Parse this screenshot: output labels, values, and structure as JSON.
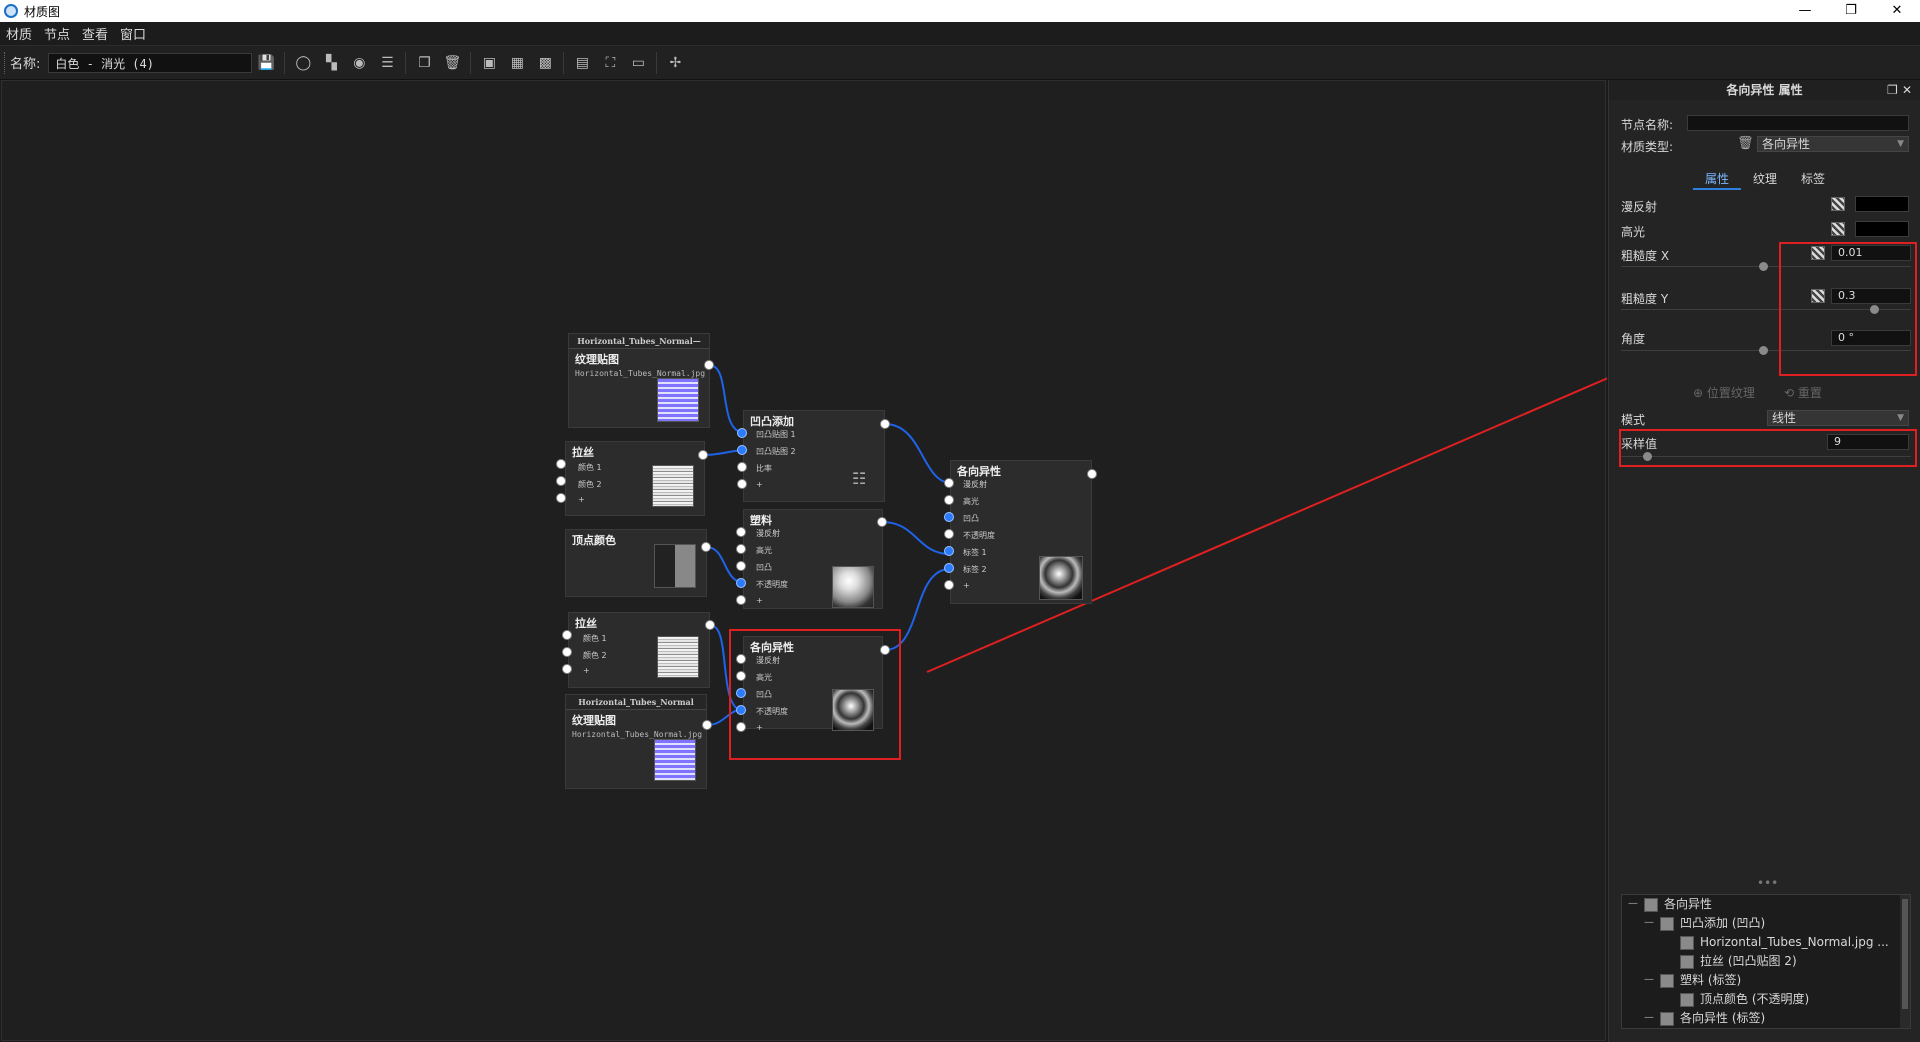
{
  "window": {
    "title": "材质图",
    "buttons": [
      "—",
      "❐",
      "✕"
    ]
  },
  "menu": [
    "材质",
    "节点",
    "查看",
    "窗口"
  ],
  "toolbar": {
    "name_label": "名称:",
    "name_value": "白色 - 消光 (4)"
  },
  "panel": {
    "title": "各向异性 属性",
    "node_name_label": "节点名称:",
    "node_name_value": "",
    "material_type_label": "材质类型:",
    "material_type_value": "各向异性",
    "tabs": [
      "属性",
      "纹理",
      "标签"
    ],
    "diffuse_label": "漫反射",
    "specular_label": "高光",
    "roughness_x_label": "粗糙度 X",
    "roughness_x_value": "0.01",
    "roughness_y_label": "粗糙度 Y",
    "roughness_y_value": "0.3",
    "angle_label": "角度",
    "angle_value": "0 °",
    "position_texture_label": "位置纹理",
    "reset_label": "重置",
    "mode_label": "模式",
    "mode_value": "线性",
    "sample_label": "采样值",
    "sample_value": "9",
    "accent": "#2f7fe0",
    "highlight": "#e02020"
  },
  "tree": [
    {
      "label": "各向异性",
      "level": 0
    },
    {
      "label": "凹凸添加 (凹凸)",
      "level": 1
    },
    {
      "label": "Horizontal_Tubes_Normal.jpg ...",
      "level": 2
    },
    {
      "label": "拉丝 (凹凸贴图 2)",
      "level": 2
    },
    {
      "label": "塑料 (标签)",
      "level": 1
    },
    {
      "label": "顶点颜色 (不透明度)",
      "level": 2
    },
    {
      "label": "各向异性 (标签)",
      "level": 1
    }
  ],
  "nodes": {
    "tex1": {
      "header": "Horizontal_Tubes_Normal—",
      "title": "纹理贴图",
      "file": "Horizontal_Tubes_Normal.jpg"
    },
    "brush1": {
      "title": "拉丝",
      "ports": [
        "颜色 1",
        "颜色 2",
        "+"
      ]
    },
    "vertex": {
      "title": "顶点颜色"
    },
    "brush2": {
      "title": "拉丝",
      "ports": [
        "颜色 1",
        "颜色 2",
        "+"
      ]
    },
    "tex2": {
      "header": "Horizontal_Tubes_Normal",
      "title": "纹理贴图",
      "file": "Horizontal_Tubes_Normal.jpg"
    },
    "bumpadd": {
      "title": "凹凸添加",
      "ports": [
        "凹凸贴图 1",
        "凹凸贴图 2",
        "比率",
        "+"
      ]
    },
    "plastic": {
      "title": "塑料",
      "ports": [
        "漫反射",
        "高光",
        "凹凸",
        "不透明度",
        "+"
      ]
    },
    "aniso": {
      "title": "各向异性",
      "ports": [
        "漫反射",
        "高光",
        "凹凸",
        "不透明度",
        "+"
      ]
    },
    "aniso_out": {
      "title": "各向异性",
      "ports": [
        "漫反射",
        "高光",
        "凹凸",
        "不透明度",
        "标签 1",
        "标签 2",
        "+"
      ]
    }
  }
}
